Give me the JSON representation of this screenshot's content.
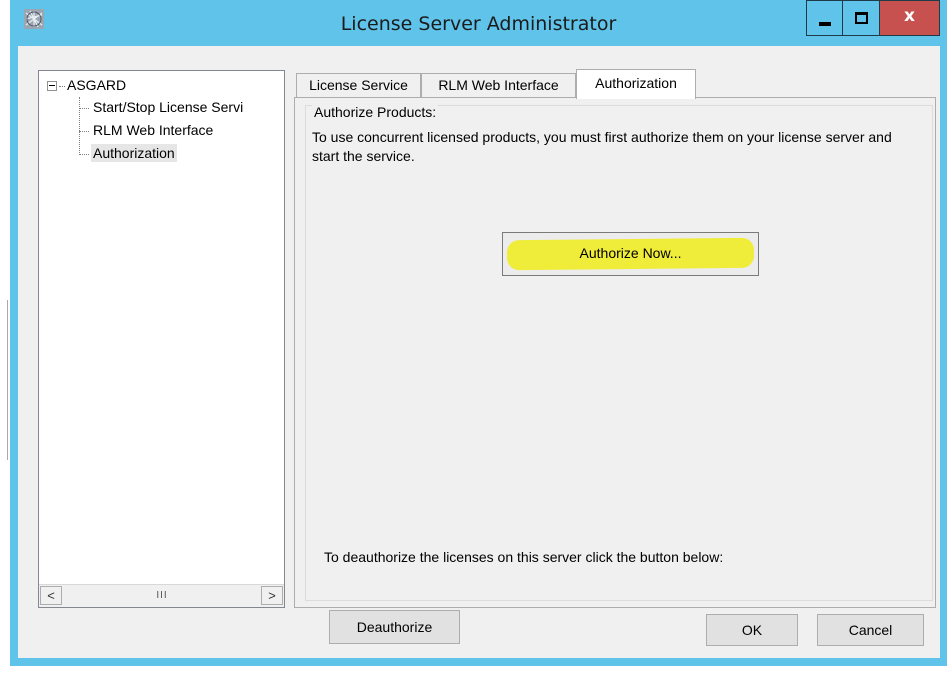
{
  "window": {
    "title": "License Server Administrator",
    "icon": "app-globe-icon",
    "controls": {
      "minimize_icon": "minimize-icon",
      "maximize_icon": "maximize-icon",
      "close_label": "x"
    },
    "colors": {
      "titlebar": "#5fc3ea",
      "close": "#c7514f",
      "highlight": "#efec3a"
    }
  },
  "tree": {
    "root": {
      "label": "ASGARD",
      "expander": "⊟"
    },
    "items": [
      {
        "label": "Start/Stop License Servi"
      },
      {
        "label": "RLM Web Interface"
      },
      {
        "label": "Authorization",
        "selected": true
      }
    ],
    "scrollbar": {
      "left": "<",
      "thumb": "III",
      "right": ">"
    }
  },
  "tabs": [
    {
      "label": "License Service"
    },
    {
      "label": "RLM Web Interface"
    },
    {
      "label": "Authorization",
      "active": true
    }
  ],
  "authorization": {
    "group_title": "Authorize Products:",
    "description": "To use concurrent licensed products, you must first authorize them on your license server and start the service.",
    "authorize_button": "Authorize Now...",
    "deauth_text": "To deauthorize the licenses on this server click the button below:",
    "deauthorize_button": "Deauthorize"
  },
  "footer": {
    "ok": "OK",
    "cancel": "Cancel"
  }
}
